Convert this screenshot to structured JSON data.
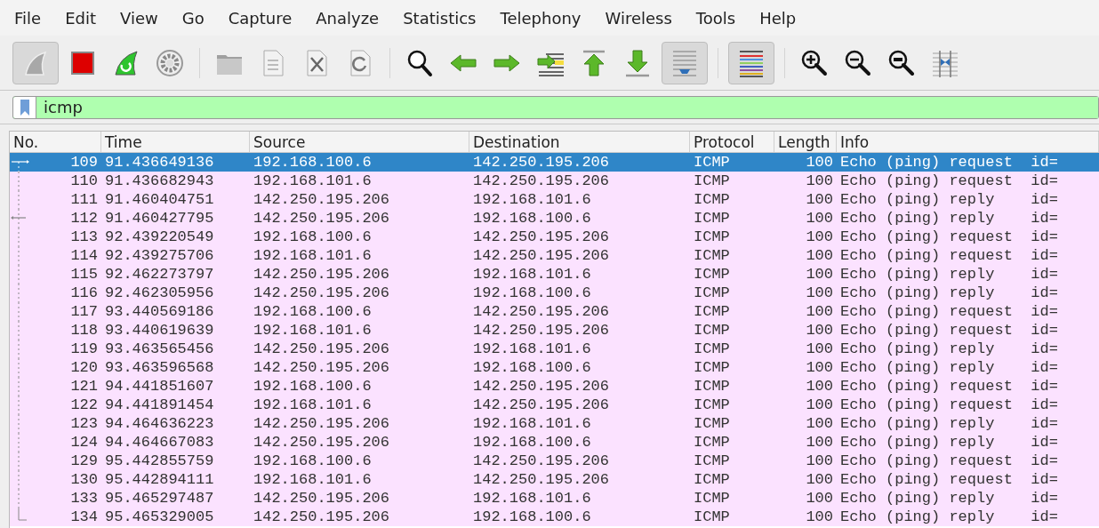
{
  "menu": [
    {
      "label": "File"
    },
    {
      "label": "Edit"
    },
    {
      "label": "View"
    },
    {
      "label": "Go"
    },
    {
      "label": "Capture"
    },
    {
      "label": "Analyze"
    },
    {
      "label": "Statistics"
    },
    {
      "label": "Telephony"
    },
    {
      "label": "Wireless"
    },
    {
      "label": "Tools"
    },
    {
      "label": "Help"
    }
  ],
  "toolbar": [
    {
      "kind": "start",
      "pressed": true
    },
    {
      "kind": "stop",
      "pressed": false
    },
    {
      "kind": "restart",
      "pressed": false
    },
    {
      "kind": "options",
      "pressed": false
    },
    {
      "kind": "separator"
    },
    {
      "kind": "open",
      "pressed": false
    },
    {
      "kind": "save",
      "pressed": false
    },
    {
      "kind": "close",
      "pressed": false
    },
    {
      "kind": "reload",
      "pressed": false
    },
    {
      "kind": "separator"
    },
    {
      "kind": "find",
      "pressed": false
    },
    {
      "kind": "back",
      "pressed": false
    },
    {
      "kind": "forward",
      "pressed": false
    },
    {
      "kind": "goto",
      "pressed": false
    },
    {
      "kind": "first",
      "pressed": false
    },
    {
      "kind": "last",
      "pressed": false
    },
    {
      "kind": "autoscroll",
      "pressed": true
    },
    {
      "kind": "separator"
    },
    {
      "kind": "colorize",
      "pressed": true
    },
    {
      "kind": "separator"
    },
    {
      "kind": "zoom-in",
      "pressed": false
    },
    {
      "kind": "zoom-out",
      "pressed": false
    },
    {
      "kind": "zoom-reset",
      "pressed": false
    },
    {
      "kind": "resize",
      "pressed": false
    }
  ],
  "filter": {
    "value": "icmp"
  },
  "table": {
    "columns": [
      "No.",
      "Time",
      "Source",
      "Destination",
      "Protocol",
      "Length",
      "Info"
    ],
    "rows": [
      {
        "cells": [
          "109",
          "91.436649136",
          "192.168.100.6",
          "142.250.195.206",
          "ICMP",
          "100",
          "Echo (ping) request  id="
        ],
        "selected": true,
        "kind": "first"
      },
      {
        "cells": [
          "110",
          "91.436682943",
          "192.168.101.6",
          "142.250.195.206",
          "ICMP",
          "100",
          "Echo (ping) request  id="
        ],
        "selected": false,
        "kind": "line"
      },
      {
        "cells": [
          "111",
          "91.460404751",
          "142.250.195.206",
          "192.168.101.6",
          "ICMP",
          "100",
          "Echo (ping) reply    id="
        ],
        "selected": false,
        "kind": "line"
      },
      {
        "cells": [
          "112",
          "91.460427795",
          "142.250.195.206",
          "192.168.100.6",
          "ICMP",
          "100",
          "Echo (ping) reply    id="
        ],
        "selected": false,
        "kind": "response"
      },
      {
        "cells": [
          "113",
          "92.439220549",
          "192.168.100.6",
          "142.250.195.206",
          "ICMP",
          "100",
          "Echo (ping) request  id="
        ],
        "selected": false,
        "kind": "line"
      },
      {
        "cells": [
          "114",
          "92.439275706",
          "192.168.101.6",
          "142.250.195.206",
          "ICMP",
          "100",
          "Echo (ping) request  id="
        ],
        "selected": false,
        "kind": "line"
      },
      {
        "cells": [
          "115",
          "92.462273797",
          "142.250.195.206",
          "192.168.101.6",
          "ICMP",
          "100",
          "Echo (ping) reply    id="
        ],
        "selected": false,
        "kind": "line"
      },
      {
        "cells": [
          "116",
          "92.462305956",
          "142.250.195.206",
          "192.168.100.6",
          "ICMP",
          "100",
          "Echo (ping) reply    id="
        ],
        "selected": false,
        "kind": "line"
      },
      {
        "cells": [
          "117",
          "93.440569186",
          "192.168.100.6",
          "142.250.195.206",
          "ICMP",
          "100",
          "Echo (ping) request  id="
        ],
        "selected": false,
        "kind": "line"
      },
      {
        "cells": [
          "118",
          "93.440619639",
          "192.168.101.6",
          "142.250.195.206",
          "ICMP",
          "100",
          "Echo (ping) request  id="
        ],
        "selected": false,
        "kind": "line"
      },
      {
        "cells": [
          "119",
          "93.463565456",
          "142.250.195.206",
          "192.168.101.6",
          "ICMP",
          "100",
          "Echo (ping) reply    id="
        ],
        "selected": false,
        "kind": "line"
      },
      {
        "cells": [
          "120",
          "93.463596568",
          "142.250.195.206",
          "192.168.100.6",
          "ICMP",
          "100",
          "Echo (ping) reply    id="
        ],
        "selected": false,
        "kind": "line"
      },
      {
        "cells": [
          "121",
          "94.441851607",
          "192.168.100.6",
          "142.250.195.206",
          "ICMP",
          "100",
          "Echo (ping) request  id="
        ],
        "selected": false,
        "kind": "line"
      },
      {
        "cells": [
          "122",
          "94.441891454",
          "192.168.101.6",
          "142.250.195.206",
          "ICMP",
          "100",
          "Echo (ping) request  id="
        ],
        "selected": false,
        "kind": "line"
      },
      {
        "cells": [
          "123",
          "94.464636223",
          "142.250.195.206",
          "192.168.101.6",
          "ICMP",
          "100",
          "Echo (ping) reply    id="
        ],
        "selected": false,
        "kind": "line"
      },
      {
        "cells": [
          "124",
          "94.464667083",
          "142.250.195.206",
          "192.168.100.6",
          "ICMP",
          "100",
          "Echo (ping) reply    id="
        ],
        "selected": false,
        "kind": "line"
      },
      {
        "cells": [
          "129",
          "95.442855759",
          "192.168.100.6",
          "142.250.195.206",
          "ICMP",
          "100",
          "Echo (ping) request  id="
        ],
        "selected": false,
        "kind": "line"
      },
      {
        "cells": [
          "130",
          "95.442894111",
          "192.168.101.6",
          "142.250.195.206",
          "ICMP",
          "100",
          "Echo (ping) request  id="
        ],
        "selected": false,
        "kind": "line"
      },
      {
        "cells": [
          "133",
          "95.465297487",
          "142.250.195.206",
          "192.168.101.6",
          "ICMP",
          "100",
          "Echo (ping) reply    id="
        ],
        "selected": false,
        "kind": "line"
      },
      {
        "cells": [
          "134",
          "95.465329005",
          "142.250.195.206",
          "192.168.100.6",
          "ICMP",
          "100",
          "Echo (ping) reply    id="
        ],
        "selected": false,
        "kind": "last"
      }
    ]
  }
}
